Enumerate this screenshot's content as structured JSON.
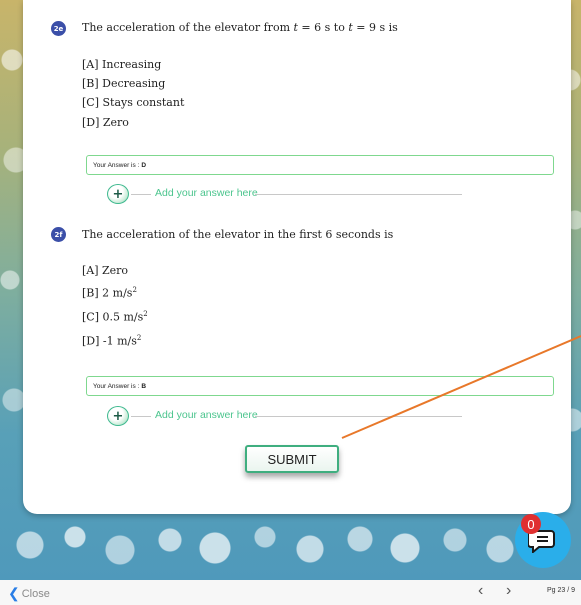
{
  "colors": {
    "badge": "#3b4fa8",
    "accent_green": "#4cc58e",
    "answer_border": "#7fd88f",
    "chat": "#2aaeea",
    "notify": "#e03030",
    "pointer_line": "#e8782a"
  },
  "questions": [
    {
      "number": "2e",
      "text_prefix": "The acceleration of the elevator from ",
      "var1": "t",
      "text_mid": " = 6 s to ",
      "var2": "t",
      "text_suffix": " = 9 s is",
      "options": [
        "[A] Increasing",
        "[B] Decreasing",
        "[C] Stays constant",
        "[D] Zero"
      ],
      "answer_label": "Your Answer is :",
      "answer_value": "D",
      "add_answer": "Add your answer here"
    },
    {
      "number": "2f",
      "text": "The acceleration of the elevator in the first 6 seconds is",
      "options": [
        {
          "base": "[A] Zero",
          "sup": ""
        },
        {
          "base": "[B] 2 m/s",
          "sup": "2"
        },
        {
          "base": "[C] 0.5 m/s",
          "sup": "2"
        },
        {
          "base": "[D] -1 m/s",
          "sup": "2"
        }
      ],
      "answer_label": "Your Answer is :",
      "answer_value": "B",
      "add_answer": "Add your answer here"
    }
  ],
  "submit_label": "SUBMIT",
  "chat": {
    "icon": "chat-icon",
    "count": "0"
  },
  "bottom_bar": {
    "close_label": "Close",
    "prev_icon": "‹",
    "next_icon": "›",
    "page": "Pg 23 / 9"
  }
}
